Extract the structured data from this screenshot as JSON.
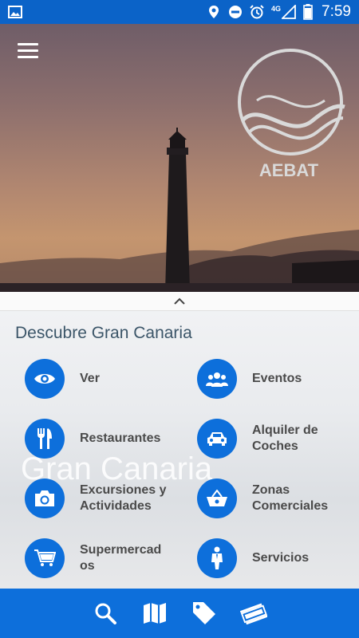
{
  "status_bar": {
    "time": "7:59",
    "network": "4G",
    "icons": [
      "image-icon",
      "location-icon",
      "do-not-disturb-icon",
      "alarm-icon",
      "signal-icon",
      "battery-icon"
    ]
  },
  "hero": {
    "logo_text": "AEBAT",
    "menu_icon": "hamburger-icon"
  },
  "panel": {
    "title": "Descubre Gran Canaria",
    "watermark": "Gran Canaria",
    "items": [
      {
        "label": "Ver",
        "icon": "eye-icon"
      },
      {
        "label": "Eventos",
        "icon": "group-icon"
      },
      {
        "label": "Restaurantes",
        "icon": "fork-knife-icon"
      },
      {
        "label": "Alquiler de Coches",
        "icon": "car-icon"
      },
      {
        "label": "Excursiones y Actividades",
        "icon": "camera-icon"
      },
      {
        "label": "Zonas Comerciales",
        "icon": "basket-icon"
      },
      {
        "label": "Supermercad os",
        "icon": "cart-icon"
      },
      {
        "label": "Servicios",
        "icon": "person-icon"
      }
    ]
  },
  "bottom_nav": {
    "items": [
      "search-icon",
      "map-icon",
      "tag-icon",
      "money-icon"
    ]
  },
  "colors": {
    "primary": "#0d6fdb",
    "status_bar": "#0b63c8",
    "title_text": "#3b5568",
    "label_text": "#4a4a4a"
  }
}
